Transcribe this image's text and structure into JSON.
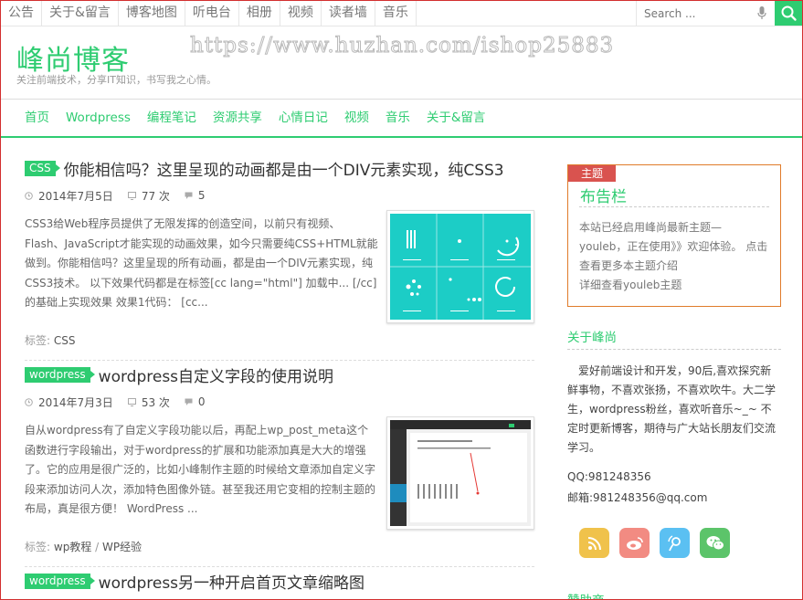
{
  "topnav": [
    "公告",
    "关于&留言",
    "博客地图",
    "听电台",
    "相册",
    "视频",
    "读者墙",
    "音乐"
  ],
  "search": {
    "placeholder": "Search ..."
  },
  "header": {
    "title": "峰尚博客",
    "description": "关注前端技术，分享IT知识，书写我之心情。",
    "watermark": "https://www.huzhan.com/ishop25883"
  },
  "mainnav": [
    "首页",
    "Wordpress",
    "编程笔记",
    "资源共享",
    "心情日记",
    "视频",
    "音乐",
    "关于&留言"
  ],
  "posts": [
    {
      "category": "CSS",
      "title": "你能相信吗？这里呈现的动画都是由一个DIV元素实现，纯CSS3",
      "date": "2014年7月5日",
      "views": "77 次",
      "comments": "5",
      "excerpt": "CSS3给Web程序员提供了无限发挥的创造空间，以前只有视频、Flash、JavaScript才能实现的动画效果，如今只需要纯CSS+HTML就能做到。你能相信吗？这里呈现的所有动画，都是由一个DIV元素实现，纯CSS3技术。 以下效果代码都是在标签[cc lang=\"html\"] 加载中... [/cc]的基础上实现效果 效果1代码： [cc...",
      "tags_label": "标签:",
      "tags": [
        "CSS"
      ]
    },
    {
      "category": "wordpress",
      "title": "wordpress自定义字段的使用说明",
      "date": "2014年7月3日",
      "views": "53 次",
      "comments": "0",
      "excerpt": "自从wordpress有了自定义字段功能以后，再配上wp_post_meta这个函数进行字段输出，对于wordpress的扩展和功能添加真是大大的增强了。它的应用是很广泛的，比如小峰制作主题的时候给文章添加自定义字段来添加访问人次，添加特色图像外链。甚至我还用它变相的控制主题的布局，真是很方便！ WordPress ...",
      "tags_label": "标签:",
      "tags": [
        "wp教程",
        "WP经验"
      ]
    },
    {
      "category": "wordpress",
      "title": "wordpress另一种开启首页文章缩略图"
    }
  ],
  "sidebar": {
    "notice_tag": "主题",
    "notice_title": "布告栏",
    "notice_body": "本站已经启用峰尚最新主题—youleb，正在使用》》欢迎体验。 点击查看更多本主题介绍",
    "notice_link": "详细查看youleb主题",
    "about_title": "关于峰尚",
    "about_text": "爱好前端设计和开发，90后,喜欢探究新鲜事物，不喜欢张扬，不喜欢吹牛。大二学生，wordpress粉丝，喜欢听音乐~_~ 不定时更新博客，期待与广大站长朋友们交流学习。",
    "qq": "QQ:981248356",
    "email": "邮箱:981248356@qq.com",
    "next_title": "赞助商",
    "socials": [
      {
        "name": "rss",
        "color": "#f0c24b"
      },
      {
        "name": "weibo",
        "color": "#f28b82"
      },
      {
        "name": "tencent-weibo",
        "color": "#5bc0f2"
      },
      {
        "name": "wechat",
        "color": "#5cc46a"
      }
    ]
  },
  "colors": {
    "accent": "#2ecc71",
    "notice_border": "#e07b2a",
    "notice_tag": "#d9534f"
  }
}
